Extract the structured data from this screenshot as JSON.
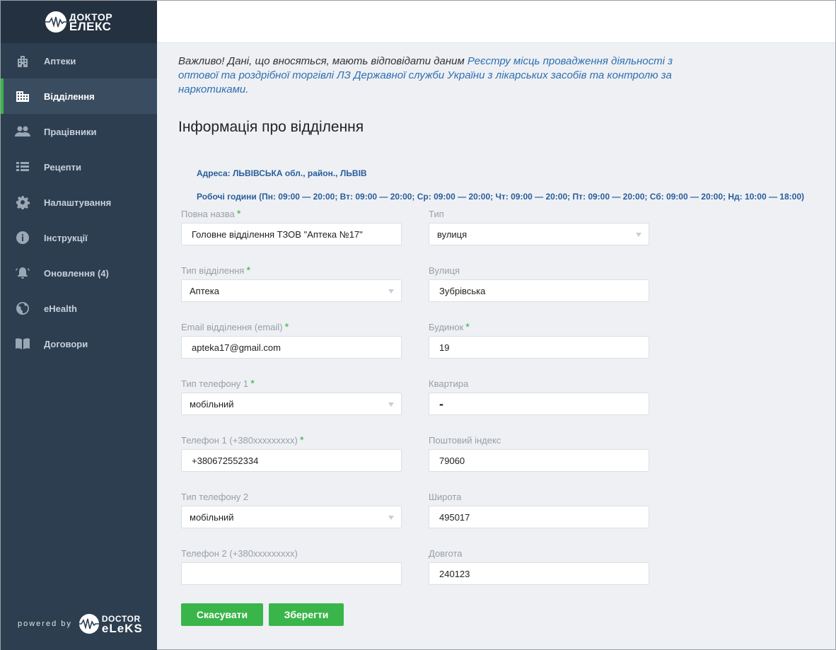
{
  "sidebar": {
    "logo": {
      "line1": "ДОКТОР",
      "line2": "ЕЛЕКС"
    },
    "items": [
      {
        "label": "Аптеки",
        "icon": "building-icon"
      },
      {
        "label": "Відділення",
        "icon": "office-icon",
        "active": true
      },
      {
        "label": "Працівники",
        "icon": "people-icon"
      },
      {
        "label": "Рецепти",
        "icon": "list-icon"
      },
      {
        "label": "Налаштування",
        "icon": "gear-icon"
      },
      {
        "label": "Інструкції",
        "icon": "info-icon"
      },
      {
        "label": "Оновлення (4)",
        "icon": "bell-icon"
      },
      {
        "label": "eHealth",
        "icon": "globe-icon"
      },
      {
        "label": "Договори",
        "icon": "book-icon"
      }
    ],
    "powered": {
      "prefix": "powered by",
      "brand1": "DOCTOR",
      "brand2": "eLeKS"
    }
  },
  "notice": {
    "text": "Важливо! Дані, що вносяться, мають відповідати даним ",
    "link": "Реєстру місць провадження діяльності з оптової та роздрібної торгівлі ЛЗ Державної служби України з лікарських засобів та контролю за наркотиками."
  },
  "section_title": "Інформація про відділення",
  "address": "Адреса: ЛЬВІВСЬКА обл., район., ЛЬВІВ",
  "hours": "Робочі години (Пн: 09:00 — 20:00; Вт: 09:00 — 20:00; Ср: 09:00 — 20:00; Чт: 09:00 — 20:00; Пт: 09:00 — 20:00; Сб: 09:00 — 20:00; Нд: 10:00 — 18:00)",
  "form": {
    "full_name": {
      "label": "Повна назва",
      "required": "*",
      "value": "Головне відділення ТЗОВ \"Аптека №17\""
    },
    "branch_type": {
      "label": "Тип відділення",
      "required": "*",
      "value": "Аптека"
    },
    "email": {
      "label": "Email відділення (email)",
      "required": "*",
      "value": "apteka17@gmail.com"
    },
    "phone1_type": {
      "label": "Тип телефону 1",
      "required": "*",
      "value": "мобільний"
    },
    "phone1": {
      "label": "Телефон 1 (+380xxxxxxxxx)",
      "required": "*",
      "value": "+380672552334"
    },
    "phone2_type": {
      "label": "Тип телефону 2",
      "value": "мобільний"
    },
    "phone2": {
      "label": "Телефон 2 (+380xxxxxxxxx)",
      "value": ""
    },
    "street_type": {
      "label": "Тип",
      "value": "вулиця"
    },
    "street": {
      "label": "Вулиця",
      "value": "Зубрівська"
    },
    "house": {
      "label": "Будинок",
      "required": "*",
      "value": "19"
    },
    "apartment": {
      "label": "Квартира",
      "value": "-"
    },
    "postal": {
      "label": "Поштовий індекс",
      "value": "79060"
    },
    "latitude": {
      "label": "Широта",
      "value": "495017"
    },
    "longitude": {
      "label": "Довгота",
      "value": "240123"
    }
  },
  "buttons": {
    "cancel": "Скасувати",
    "save": "Зберегти"
  },
  "colors": {
    "sidebar": "#2d3e50",
    "accent": "#3ab54a",
    "link": "#2f6fb0"
  }
}
